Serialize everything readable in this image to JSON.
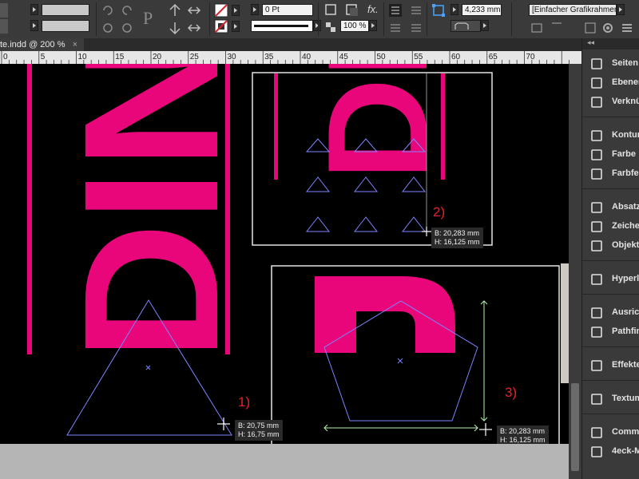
{
  "control_bar": {
    "stroke_weight": "0 Pt",
    "opacity": "100 %",
    "dimension": "4,233 mm",
    "object_style": "[Einfacher Grafikrahmen]+",
    "fx_label": "fx."
  },
  "document_tab": {
    "title": "te.indd @ 200 %",
    "close": "×"
  },
  "ruler": {
    "ticks": [
      "0",
      "5",
      "10",
      "15",
      "20",
      "25",
      "30",
      "35",
      "40",
      "45",
      "50",
      "55",
      "60",
      "65",
      "70"
    ]
  },
  "canvas": {
    "letters": {
      "left_group": "DINN",
      "top_right_group": "DI",
      "bottom_right_group": "D"
    },
    "annotations": {
      "a1": "1)",
      "a2": "2)",
      "a3": "3)"
    },
    "tooltips": {
      "t1": {
        "w": "B: 20,75 mm",
        "h": "H: 16,75 mm"
      },
      "t2": {
        "w": "B: 20,283 mm",
        "h": "H: 16,125 mm"
      },
      "t3": {
        "w": "B: 20,283 mm",
        "h": "H: 16,125 mm"
      }
    }
  },
  "panel": {
    "items": [
      "Seiten",
      "Ebenen",
      "Verknü",
      "Kontur",
      "Farbe",
      "Farbfel",
      "Absatzf",
      "Zeicher",
      "Objektf",
      "Hyperli",
      "Ausrich",
      "Pathfin",
      "Effekte",
      "Textum",
      "Comma",
      "4eck-M"
    ]
  },
  "colors": {
    "magenta": "#e8067a",
    "frame": "#e6e6e6",
    "shape_stroke": "#7c83ff",
    "annotation": "#e8202a"
  }
}
